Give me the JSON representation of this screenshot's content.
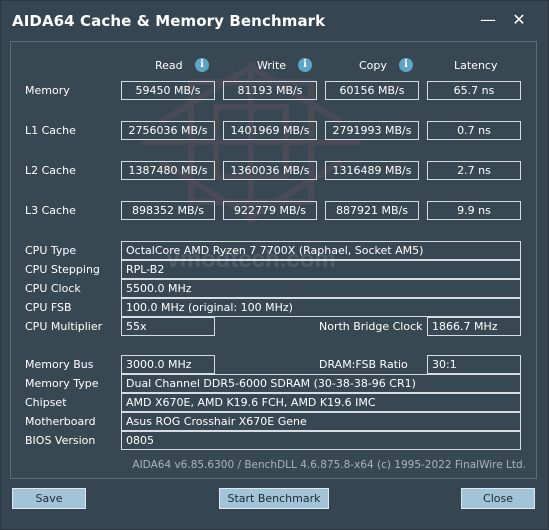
{
  "window": {
    "title": "AIDA64 Cache & Memory Benchmark",
    "minimize_glyph": "—",
    "close_glyph": "✕"
  },
  "columns": {
    "read": "Read",
    "write": "Write",
    "copy": "Copy",
    "latency": "Latency",
    "info_glyph": "i"
  },
  "bench": {
    "memory": {
      "label": "Memory",
      "read": "59450 MB/s",
      "write": "81193 MB/s",
      "copy": "60156 MB/s",
      "latency": "65.7 ns"
    },
    "l1": {
      "label": "L1 Cache",
      "read": "2756036 MB/s",
      "write": "1401969 MB/s",
      "copy": "2791993 MB/s",
      "latency": "0.7 ns"
    },
    "l2": {
      "label": "L2 Cache",
      "read": "1387480 MB/s",
      "write": "1360036 MB/s",
      "copy": "1316489 MB/s",
      "latency": "2.7 ns"
    },
    "l3": {
      "label": "L3 Cache",
      "read": "898352 MB/s",
      "write": "922779 MB/s",
      "copy": "887921 MB/s",
      "latency": "9.9 ns"
    }
  },
  "cpu": {
    "type_label": "CPU Type",
    "type": "OctalCore AMD Ryzen 7 7700X  (Raphael, Socket AM5)",
    "stepping_label": "CPU Stepping",
    "stepping": "RPL-B2",
    "clock_label": "CPU Clock",
    "clock": "5500.0 MHz",
    "fsb_label": "CPU FSB",
    "fsb": "100.0 MHz  (original: 100 MHz)",
    "multiplier_label": "CPU Multiplier",
    "multiplier": "55x",
    "nb_clock_label": "North Bridge Clock",
    "nb_clock": "1866.7 MHz"
  },
  "system": {
    "membus_label": "Memory Bus",
    "membus": "3000.0 MHz",
    "dramfsb_label": "DRAM:FSB Ratio",
    "dramfsb": "30:1",
    "memtype_label": "Memory Type",
    "memtype": "Dual Channel DDR5-6000 SDRAM  (30-38-38-96 CR1)",
    "chipset_label": "Chipset",
    "chipset": "AMD X670E, AMD K19.6 FCH, AMD K19.6 IMC",
    "mobo_label": "Motherboard",
    "mobo": "Asus ROG Crosshair X670E Gene",
    "bios_label": "BIOS Version",
    "bios": "0805"
  },
  "footer": "AIDA64 v6.85.6300 / BenchDLL 4.6.875.8-x64  (c) 1995-2022 FinalWire Ltd.",
  "buttons": {
    "save": "Save",
    "start": "Start Benchmark",
    "close": "Close"
  },
  "watermark": "vmodtech.com",
  "colors": {
    "window_bg": "#354552",
    "button_bg": "#a2c4d6",
    "info_icon": "#5ea3c8"
  }
}
